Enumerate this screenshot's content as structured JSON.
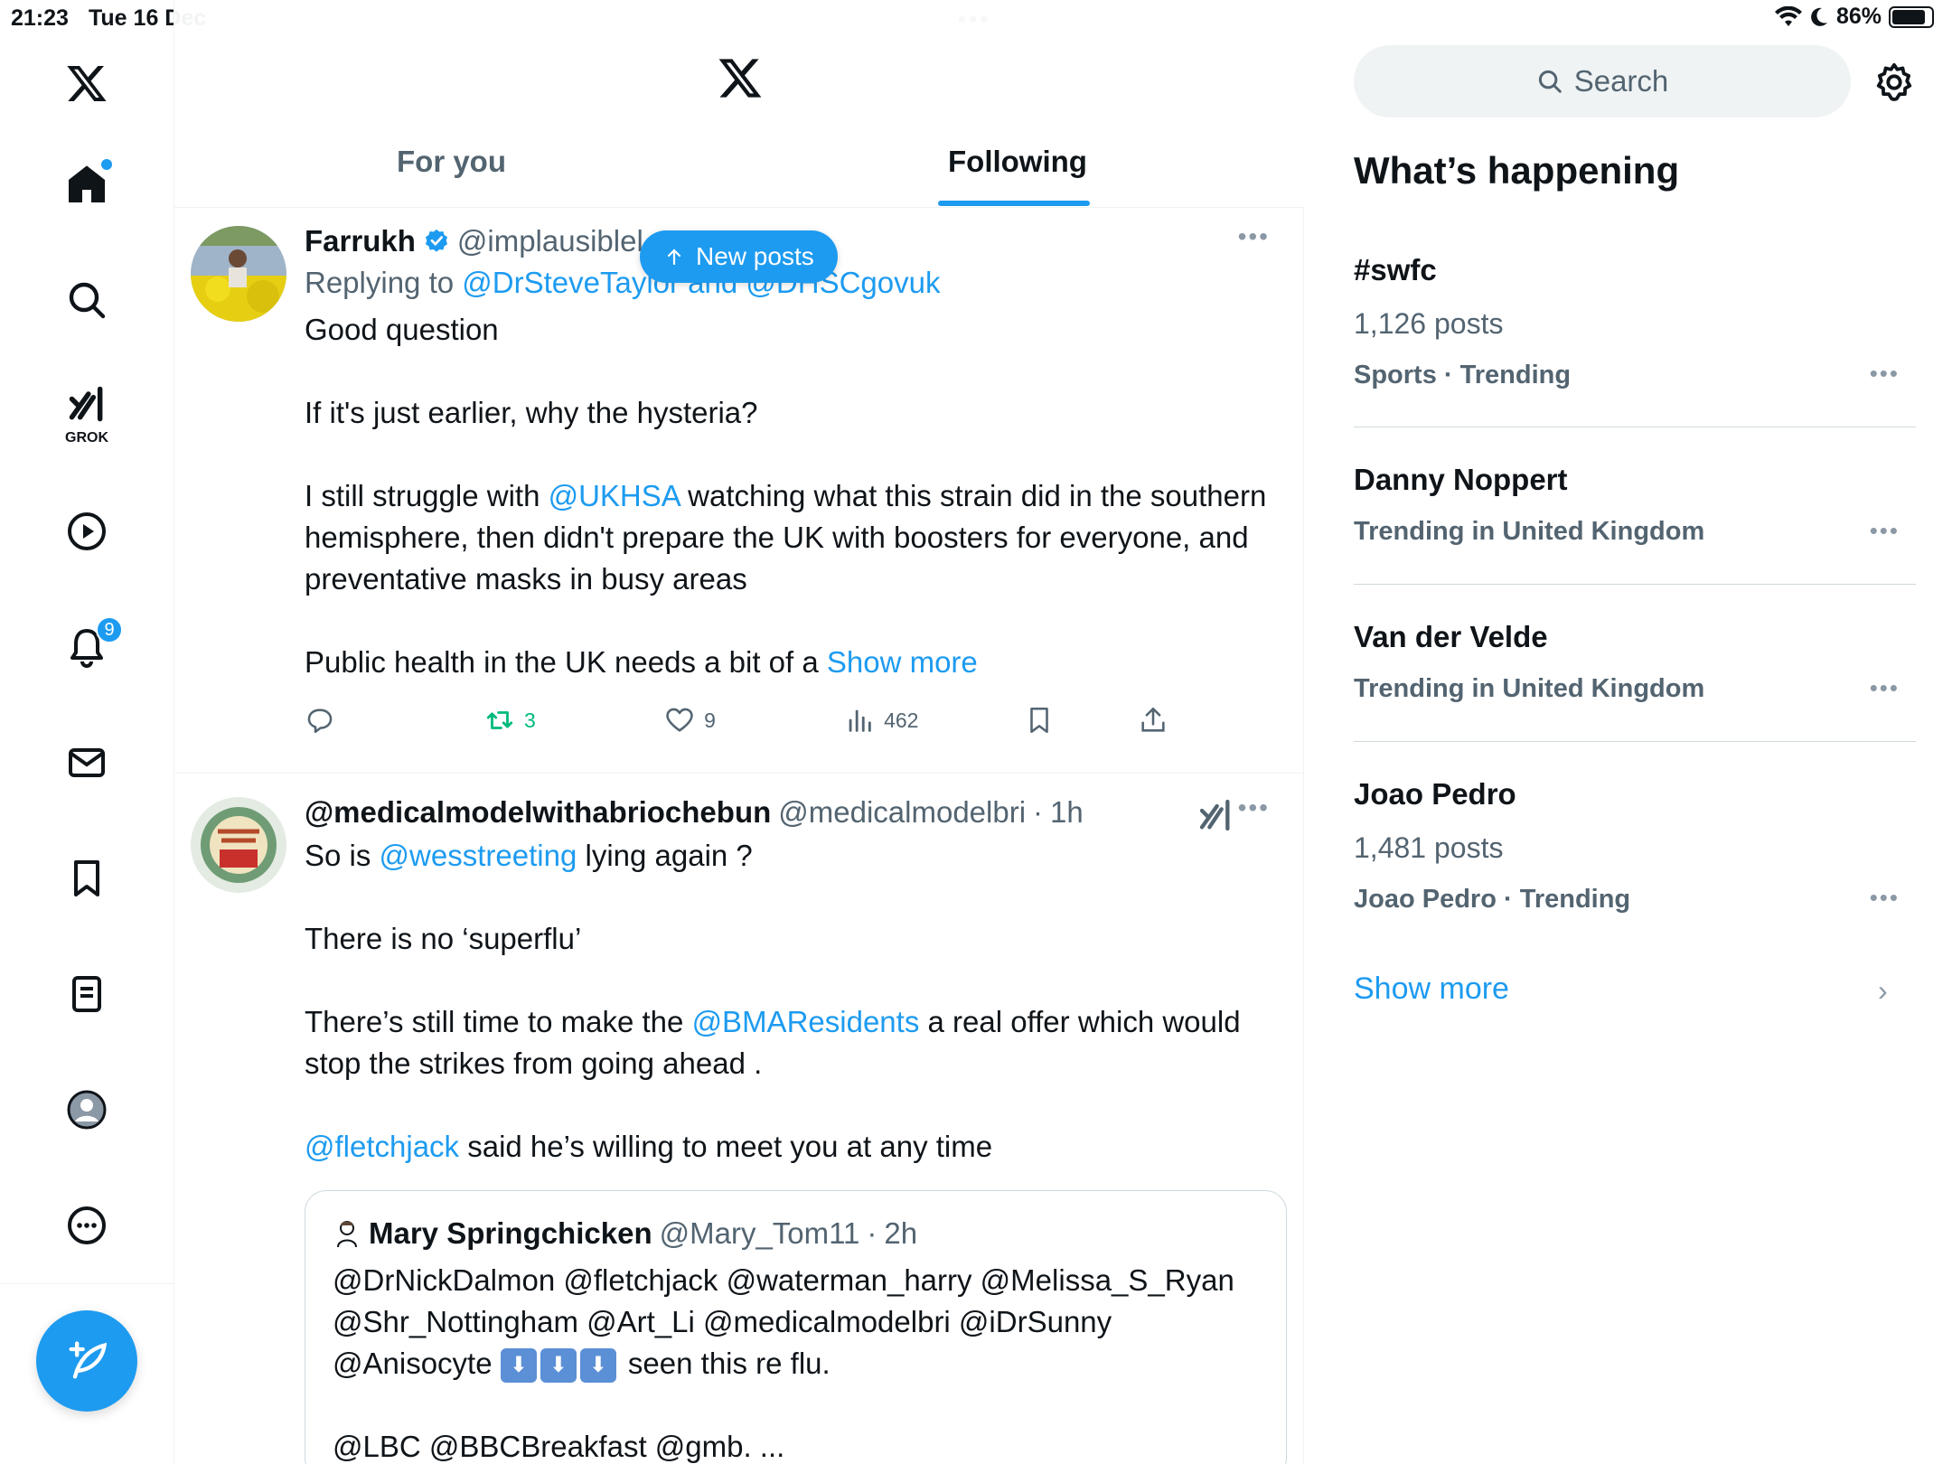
{
  "status_bar": {
    "time": "21:23",
    "date": "Tue 16 Dec",
    "battery": "86%",
    "battery_level": 0.86
  },
  "nav": {
    "notifications_badge": "9",
    "grok_label": "GROK"
  },
  "header": {
    "tabs": [
      {
        "label": "For you"
      },
      {
        "label": "Following"
      }
    ],
    "active_tab": "Following",
    "new_posts_label": "New posts"
  },
  "tweets": [
    {
      "name": "Farrukh",
      "handle": "@implausiblel",
      "verified": true,
      "replying_prefix": "Replying to",
      "replying_to": "@DrSteveTaylor and @DHSCgovuk",
      "text": {
        "p1": "Good question",
        "p2": "If it's just earlier, why the hysteria?",
        "p3_a": "I still struggle with ",
        "p3_mention": "@UKHSA",
        "p3_b": " watching what this strain did in the southern hemisphere, then didn't prepare the UK with boosters for everyone, and preventative masks in busy areas",
        "p4": "Public health in the UK needs a bit of a ",
        "show_more": "Show more"
      },
      "retweets": "3",
      "likes": "9",
      "views": "462"
    },
    {
      "name": "@medicalmodelwithabriochebun",
      "handle": "@medicalmodelbri",
      "time": "1h",
      "text": {
        "p1_a": "So is ",
        "p1_mention": "@wesstreeting",
        "p1_b": " lying again ?",
        "p2": "There is no ‘superflu’",
        "p3_a": "There’s still time to make the ",
        "p3_mention": "@BMAResidents",
        "p3_b": " a real offer which would stop the strikes from going ahead .",
        "p4_mention": "@fletchjack",
        "p4_b": " said he’s willing to meet you at any time"
      },
      "quote": {
        "name": "Mary Springchicken",
        "handle": "@Mary_Tom11",
        "time": "2h",
        "line1": "@DrNickDalmon @fletchjack @waterman_harry @Melissa_S_Ryan",
        "line2": "@Shr_Nottingham @Art_Li @medicalmodelbri @iDrSunny",
        "line3_a": "@Anisocyte ",
        "line3_b": " seen this re flu.",
        "line4": "@LBC @BBCBreakfast @gmb. ..."
      }
    }
  ],
  "sidebar": {
    "search_placeholder": "Search",
    "title": "What’s happening",
    "trends": [
      {
        "name": "#swfc",
        "posts": "1,126 posts",
        "meta": "Sports · Trending"
      },
      {
        "name": "Danny Noppert",
        "meta": "Trending in United Kingdom"
      },
      {
        "name": "Van der Velde",
        "meta": "Trending in United Kingdom"
      },
      {
        "name": "Joao Pedro",
        "posts": "1,481 posts",
        "meta": "Joao Pedro · Trending"
      }
    ],
    "show_more": "Show more"
  },
  "colors": {
    "accent": "#1d9bf0",
    "text": "#0f1419",
    "muted": "#536471",
    "retweet": "#00ba7c"
  }
}
